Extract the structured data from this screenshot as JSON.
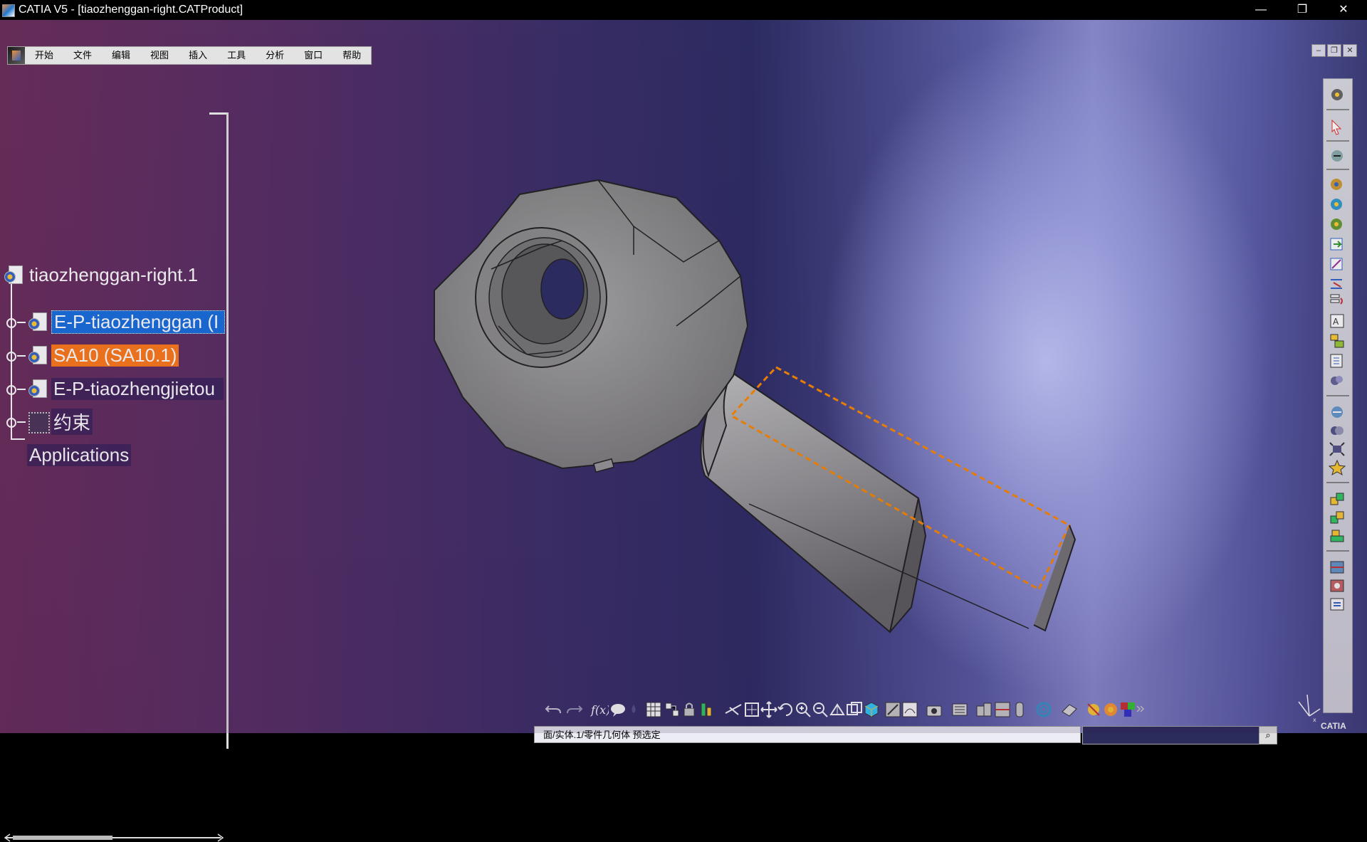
{
  "window": {
    "title": "CATIA V5 - [tiaozhenggan-right.CATProduct]",
    "controls": {
      "minimize": "—",
      "restore": "❐",
      "close": "✕"
    }
  },
  "menu": {
    "items": [
      "开始",
      "文件",
      "编辑",
      "视图",
      "插入",
      "工具",
      "分析",
      "窗口",
      "帮助"
    ]
  },
  "mdi": {
    "minimize": "–",
    "restore": "❐",
    "close": "✕"
  },
  "tree": {
    "root": "tiaozhenggan-right.1",
    "children": [
      {
        "label": "E-P-tiaozhenggan (I",
        "state": "selected",
        "icon": "product-icon"
      },
      {
        "label": "SA10 (SA10.1)",
        "state": "highlighted",
        "icon": "product-icon"
      },
      {
        "label": "E-P-tiaozhengjietou",
        "state": "normal",
        "icon": "product-icon"
      },
      {
        "label": "约束",
        "state": "normal",
        "icon": "constraints-icon"
      }
    ],
    "applications": "Applications"
  },
  "status": {
    "message": "面/实体.1/零件几何体 预选定",
    "command_value": ""
  },
  "colors": {
    "selected_bg": "#1a6fe0",
    "highlight_bg": "#ff7a1a",
    "part_gray": "#9a9a9a",
    "preselect_edge": "#ff8a00"
  },
  "brand": {
    "logo_text": "CATIA"
  }
}
